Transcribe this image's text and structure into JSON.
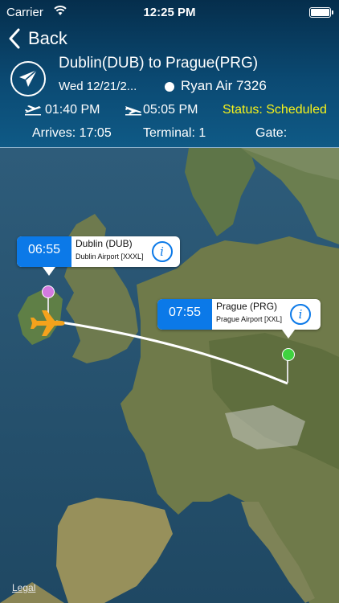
{
  "status_bar": {
    "carrier": "Carrier",
    "time": "12:25 PM"
  },
  "nav": {
    "back_label": "Back"
  },
  "flight": {
    "route_title": "Dublin(DUB) to Prague(PRG)",
    "date": "Wed 12/21/2...",
    "airline": "Ryan Air 7326",
    "departure_time": "01:40 PM",
    "arrival_time": "05:05 PM",
    "status": "Status: Scheduled",
    "arrives": "Arrives: 17:05",
    "terminal": "Terminal: 1",
    "gate": "Gate:"
  },
  "map": {
    "origin": {
      "time": "06:55",
      "city": "Dublin (DUB)",
      "airport": "Dublin Airport [XXXL]",
      "pin_color": "#d37ae0"
    },
    "destination": {
      "time": "07:55",
      "city": "Prague (PRG)",
      "airport": "Prague Airport [XXL]",
      "pin_color": "#3fd23f"
    },
    "legal_label": "Legal"
  },
  "colors": {
    "accent": "#0b79e8",
    "status": "#f7f21a",
    "plane": "#f5a21c"
  }
}
